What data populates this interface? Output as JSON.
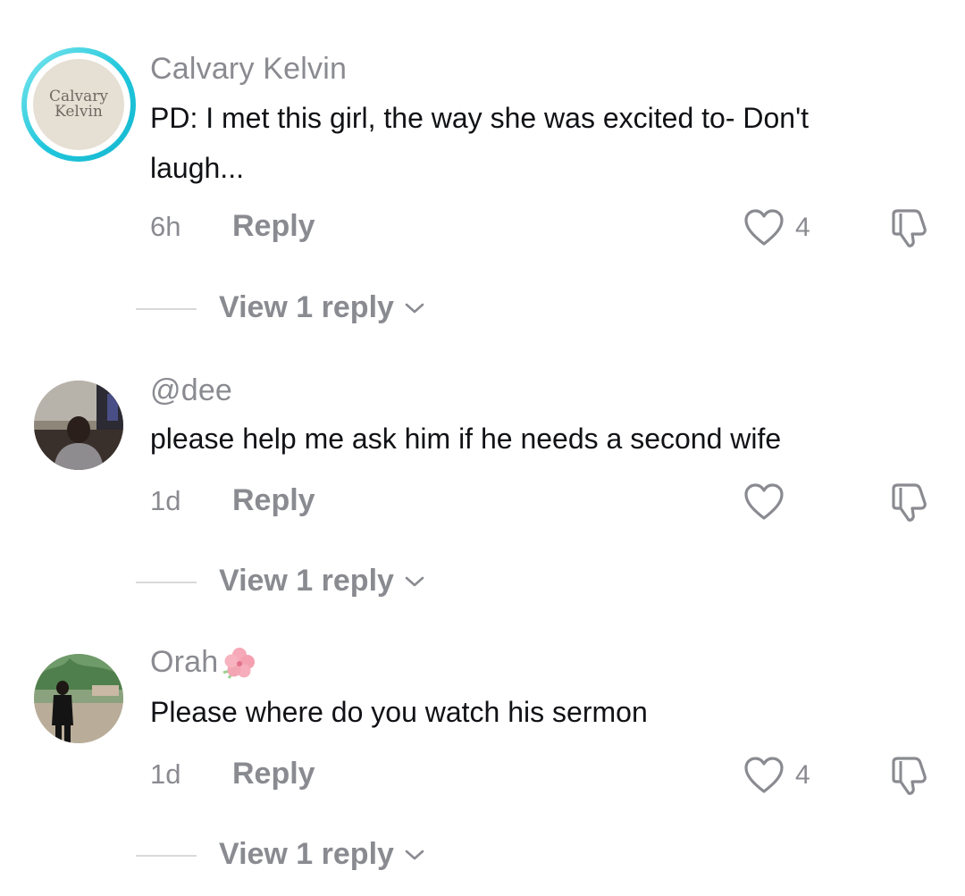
{
  "comments": [
    {
      "username": "Calvary Kelvin",
      "avatar_text_line1": "Calvary",
      "avatar_text_line2": "Kelvin",
      "text_line1": "PD: I met this girl, the way she was excited to- Don't",
      "text_line2": "laugh...",
      "time": "6h",
      "reply_label": "Reply",
      "likes": "4",
      "view_replies": "View 1 reply",
      "avatar_ring_color": "#1fc6db"
    },
    {
      "username": "@dee",
      "text_line1": "please help me ask him if he needs a second wife",
      "time": "1d",
      "reply_label": "Reply",
      "likes": "",
      "view_replies": "View 1 reply"
    },
    {
      "username": "Orah",
      "username_emoji": "hibiscus-icon",
      "text_line1": "Please where do you watch his sermon",
      "time": "1d",
      "reply_label": "Reply",
      "likes": "4",
      "view_replies": "View 1 reply"
    }
  ],
  "icons": {
    "like": "heart-icon",
    "dislike": "thumbs-down-icon",
    "expand": "chevron-down-icon"
  },
  "colors": {
    "meta_gray": "#8a8b91",
    "text": "#111216"
  }
}
